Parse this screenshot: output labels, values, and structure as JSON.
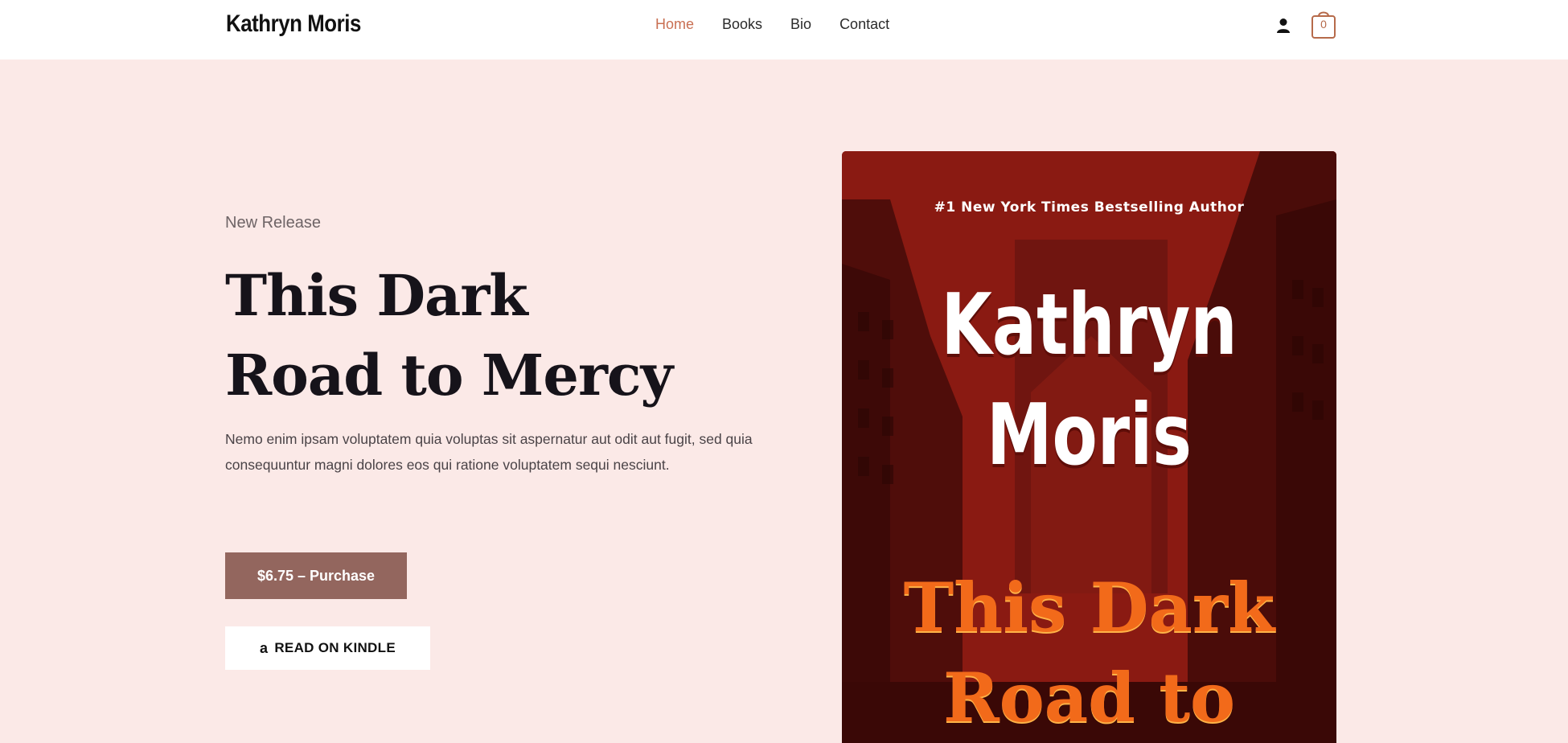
{
  "header": {
    "logo": "Kathryn Moris",
    "nav": [
      {
        "label": "Home",
        "active": true
      },
      {
        "label": "Books",
        "active": false
      },
      {
        "label": "Bio",
        "active": false
      },
      {
        "label": "Contact",
        "active": false
      }
    ],
    "account_icon": "user-icon",
    "cart_icon": "bag-icon",
    "cart_count": "0"
  },
  "hero": {
    "eyebrow": "New Release",
    "title_line1": "This Dark",
    "title_line2": "Road to Mercy",
    "description": "Nemo enim ipsam voluptatem quia voluptas sit aspernatur aut odit aut fugit, sed quia consequuntur magni dolores eos qui ratione voluptatem sequi nesciunt.",
    "purchase_button": "$6.75 – Purchase",
    "kindle_button": "READ ON KINDLE",
    "kindle_icon": "amazon-icon"
  },
  "cover": {
    "tagline": "#1 New York Times Bestselling Author",
    "author_line1": "Kathryn",
    "author_line2": "Moris",
    "title_line1": "This Dark",
    "title_line2": "Road to"
  },
  "colors": {
    "background": "#fbe9e7",
    "accent": "#c96f52",
    "button": "#93665e",
    "cover": "#7a1410",
    "cover_title": "#f26a1a"
  }
}
